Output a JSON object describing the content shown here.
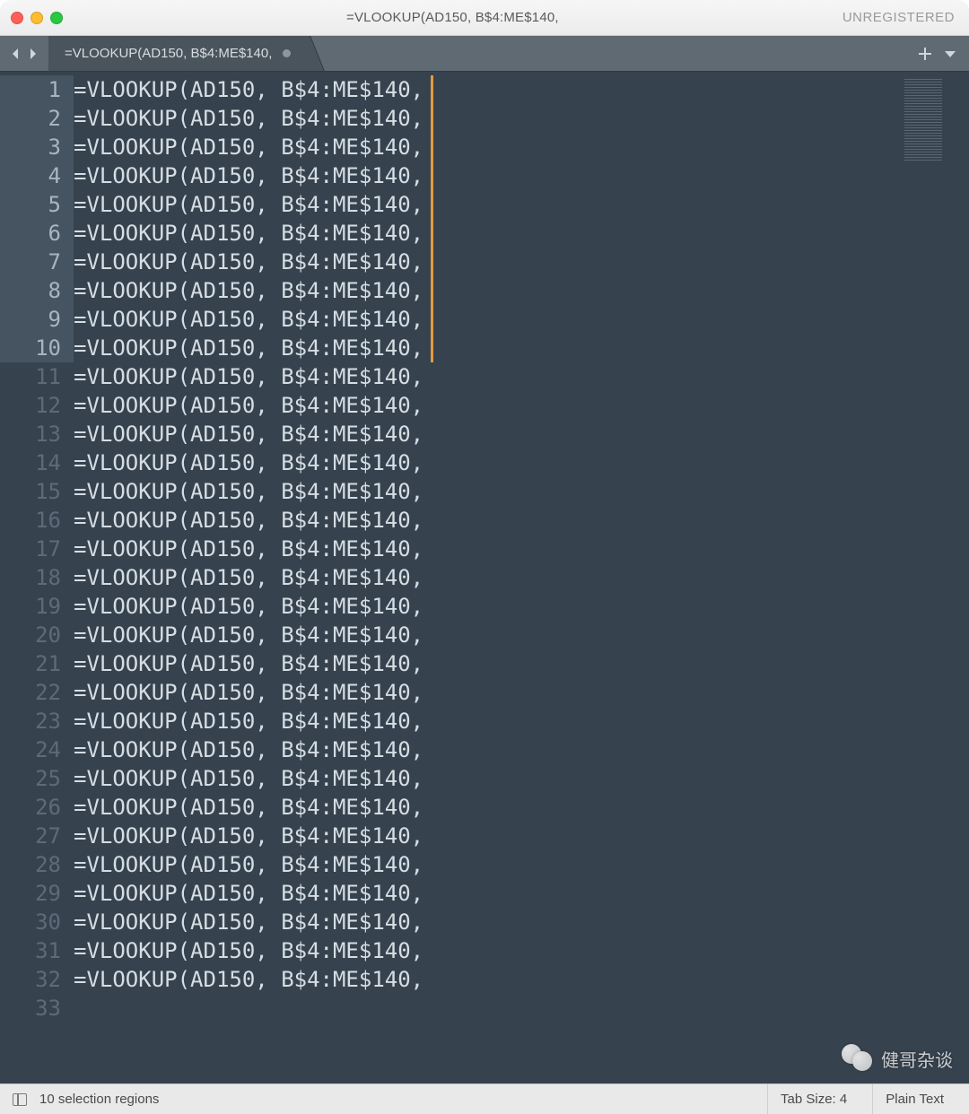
{
  "titlebar": {
    "title": "=VLOOKUP(AD150, B$4:ME$140,",
    "unregistered": "UNREGISTERED"
  },
  "tab": {
    "label": "=VLOOKUP(AD150, B$4:ME$140,",
    "modified": true
  },
  "editor": {
    "total_lines": 33,
    "selected_lines": [
      1,
      2,
      3,
      4,
      5,
      6,
      7,
      8,
      9,
      10
    ],
    "caret_lines": [
      1,
      2,
      3,
      4,
      5,
      6,
      7,
      8,
      9,
      10
    ],
    "content_line": "=VLOOKUP(AD150, B$4:ME$140,",
    "empty_last_line": true
  },
  "statusbar": {
    "selection": "10 selection regions",
    "tab_size": "Tab Size: 4",
    "syntax": "Plain Text"
  },
  "watermark": {
    "text": "健哥杂谈"
  }
}
